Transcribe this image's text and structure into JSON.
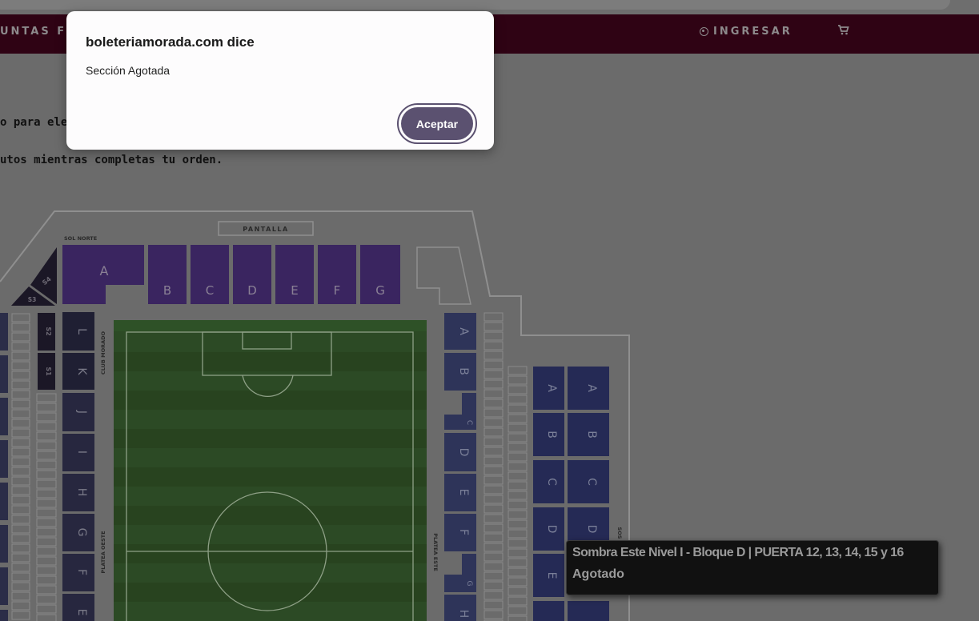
{
  "nav": {
    "left_text": "UNTAS FR",
    "login_label": "INGRESAR",
    "cart_icon": "shopping-cart-icon",
    "user_icon": "user-circle-icon"
  },
  "instructions": {
    "line1": "o para eleg",
    "line2": "utos mientras completas tu orden."
  },
  "map": {
    "pantalla": "PANTALLA",
    "sol_norte": "SOL NORTE",
    "club_morado": "CLUB MORADO",
    "platea_oeste": "PLATEA OESTE",
    "platea_este": "PLATEA ESTE",
    "sos": "SOS",
    "north_sections": [
      "A",
      "B",
      "C",
      "D",
      "E",
      "F",
      "G"
    ],
    "small_sections": [
      "S4",
      "S3",
      "S2",
      "S1"
    ],
    "west_sections": [
      "L",
      "K",
      "J",
      "I",
      "H",
      "G",
      "F",
      "E"
    ],
    "east_sections": [
      "A",
      "B",
      "C",
      "D",
      "E",
      "F",
      "G",
      "H"
    ],
    "far_east_col1": [
      "A",
      "B",
      "C",
      "D",
      "E"
    ],
    "far_east_col2": [
      "A",
      "B",
      "C",
      "D"
    ]
  },
  "tooltip": {
    "title": "Sombra Este Nivel I - Bloque D | PUERTA 12, 13, 14, 15 y 16",
    "status": "Agotado"
  },
  "dialog": {
    "title": "boleteriamorada.com dice",
    "message": "Sección Agotada",
    "button_label": "Aceptar"
  },
  "colors": {
    "nav_bg": "#2f0314",
    "north_purple": "#3a2560",
    "small_section": "#1b1726",
    "west_section": "#27273f",
    "east_section": "#2e3459",
    "field_green": "#2c4a25",
    "dialog_button": "#5b5170"
  }
}
